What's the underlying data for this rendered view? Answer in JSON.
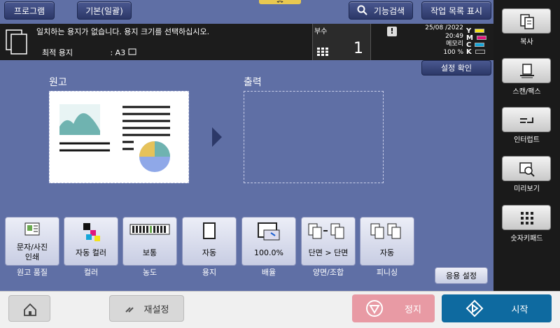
{
  "top_tabs": {
    "program": "프로그램",
    "basic": "기본(일괄)",
    "search": "기능검색",
    "job_list": "작업 목록 표시"
  },
  "message": {
    "text": "일치하는 용지가 없습니다. 용지 크기를 선택하십시오.",
    "paper_label": "최적 용지",
    "paper_value": ": A3"
  },
  "copies": {
    "label": "부수",
    "value": "1"
  },
  "status": {
    "date": "25/08 /2022",
    "time": "20:49",
    "memory_label": "메모리",
    "memory_value": "100 %"
  },
  "toner": [
    {
      "name": "Y",
      "color": "#f3e21a"
    },
    {
      "name": "M",
      "color": "#e0157e"
    },
    {
      "name": "C",
      "color": "#16a6d9"
    },
    {
      "name": "K",
      "color": "#222222"
    }
  ],
  "confirm_settings": "설정 확인",
  "preview": {
    "original_label": "원고",
    "output_label": "출력"
  },
  "functions": [
    {
      "value": "문자/사진\n인쇄",
      "label": "원고 품질",
      "icon": "original-type-icon"
    },
    {
      "value": "자동 컬러",
      "label": "컬러",
      "icon": "color-icon"
    },
    {
      "value": "보통",
      "label": "농도",
      "icon": "density-icon"
    },
    {
      "value": "자동",
      "label": "용지",
      "icon": "paper-icon"
    },
    {
      "value": "100.0%",
      "label": "배율",
      "icon": "zoom-icon"
    },
    {
      "value": "단면 > 단면",
      "label": "양면/조합",
      "icon": "duplex-icon"
    },
    {
      "value": "자동",
      "label": "피니싱",
      "icon": "finishing-icon"
    }
  ],
  "application_settings": "응용 설정",
  "right_panel": [
    {
      "label": "복사",
      "icon": "copy-icon"
    },
    {
      "label": "스캔/팩스",
      "icon": "scan-fax-icon"
    },
    {
      "label": "인터럽트",
      "icon": "interrupt-icon"
    },
    {
      "label": "미리보기",
      "icon": "preview-icon"
    },
    {
      "label": "숫자키패드",
      "icon": "keypad-icon"
    }
  ],
  "bottom": {
    "reset": "재설정",
    "stop": "정지",
    "start": "시작"
  }
}
